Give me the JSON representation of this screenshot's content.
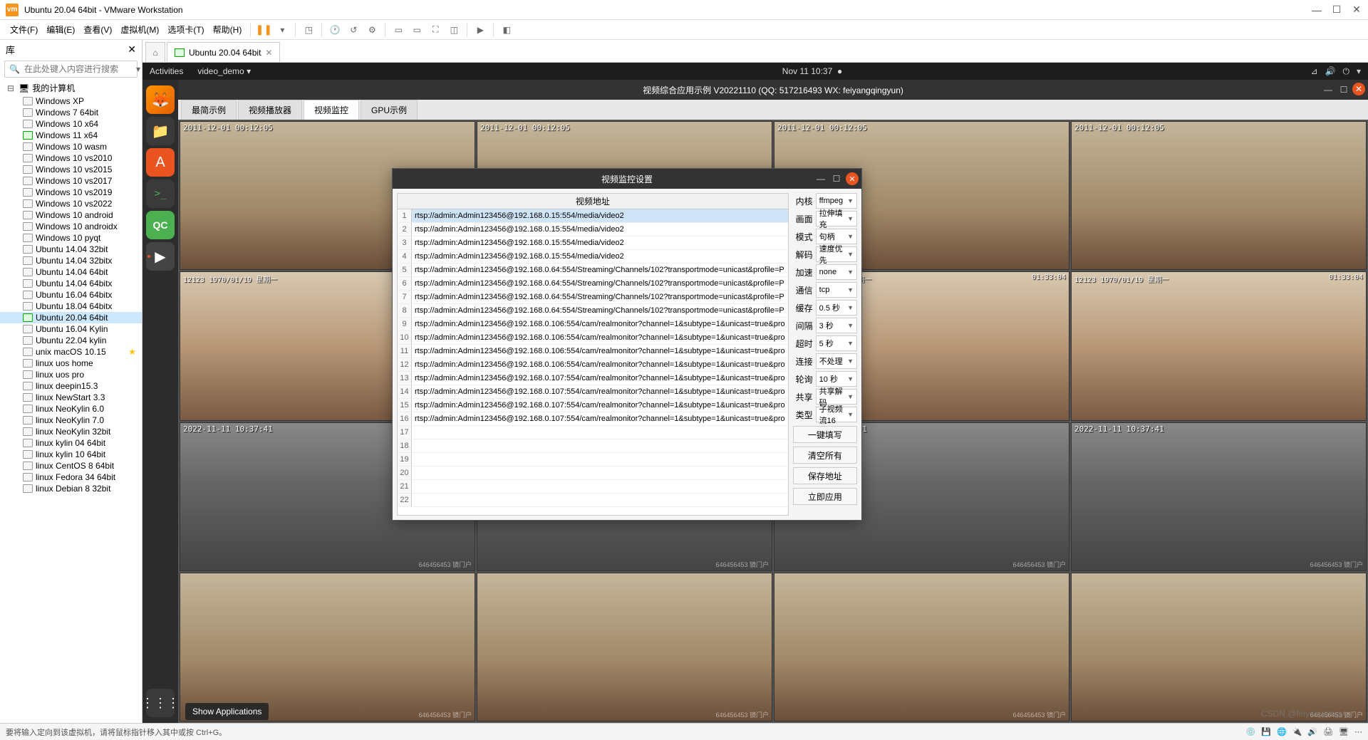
{
  "vmware": {
    "title": "Ubuntu 20.04 64bit - VMware Workstation",
    "menu": [
      "文件(F)",
      "编辑(E)",
      "查看(V)",
      "虚拟机(M)",
      "选项卡(T)",
      "帮助(H)"
    ],
    "tab_label": "Ubuntu 20.04 64bit",
    "status": "要将输入定向到该虚拟机，请将鼠标指针移入其中或按 Ctrl+G。"
  },
  "library": {
    "title": "库",
    "search_placeholder": "在此处键入内容进行搜索",
    "root": "我的计算机",
    "vms": [
      {
        "name": "Windows XP",
        "on": false
      },
      {
        "name": "Windows 7 64bit",
        "on": false
      },
      {
        "name": "Windows 10 x64",
        "on": false
      },
      {
        "name": "Windows 11 x64",
        "on": true
      },
      {
        "name": "Windows 10 wasm",
        "on": false
      },
      {
        "name": "Windows 10 vs2010",
        "on": false
      },
      {
        "name": "Windows 10 vs2015",
        "on": false
      },
      {
        "name": "Windows 10 vs2017",
        "on": false
      },
      {
        "name": "Windows 10 vs2019",
        "on": false
      },
      {
        "name": "Windows 10 vs2022",
        "on": false
      },
      {
        "name": "Windows 10 android",
        "on": false
      },
      {
        "name": "Windows 10 androidx",
        "on": false
      },
      {
        "name": "Windows 10 pyqt",
        "on": false
      },
      {
        "name": "Ubuntu 14.04 32bit",
        "on": false
      },
      {
        "name": "Ubuntu 14.04 32bitx",
        "on": false
      },
      {
        "name": "Ubuntu 14.04 64bit",
        "on": false
      },
      {
        "name": "Ubuntu 14.04 64bitx",
        "on": false
      },
      {
        "name": "Ubuntu 16.04 64bitx",
        "on": false
      },
      {
        "name": "Ubuntu 18.04 64bitx",
        "on": false
      },
      {
        "name": "Ubuntu 20.04 64bit",
        "on": true,
        "active": true
      },
      {
        "name": "Ubuntu 16.04 Kylin",
        "on": false
      },
      {
        "name": "Ubuntu 22.04 kylin",
        "on": false
      },
      {
        "name": "unix macOS 10.15",
        "on": false,
        "star": true
      },
      {
        "name": "linux uos home",
        "on": false
      },
      {
        "name": "linux uos pro",
        "on": false
      },
      {
        "name": "linux deepin15.3",
        "on": false
      },
      {
        "name": "linux NewStart 3.3",
        "on": false
      },
      {
        "name": "linux NeoKylin 6.0",
        "on": false
      },
      {
        "name": "linux NeoKylin 7.0",
        "on": false
      },
      {
        "name": "linux NeoKylin 32bit",
        "on": false
      },
      {
        "name": "linux kylin 04 64bit",
        "on": false
      },
      {
        "name": "linux kylin 10 64bit",
        "on": false
      },
      {
        "name": "linux CentOS 8 64bit",
        "on": false
      },
      {
        "name": "linux Fedora 34 64bit",
        "on": false
      },
      {
        "name": "linux Debian 8 32bit",
        "on": false
      }
    ]
  },
  "ubuntu": {
    "activities": "Activities",
    "app_menu": "video_demo",
    "clock": "Nov 11  10:37",
    "show_apps_tip": "Show Applications"
  },
  "vapp": {
    "title": "视频综合应用示例 V20221110 (QQ: 517216493 WX: feiyangqingyun)",
    "tabs": [
      "最简示例",
      "视频播放器",
      "视频监控",
      "GPU示例"
    ],
    "active_tab": 2,
    "timestamps_row1": "2011-12-01 00:12:05",
    "timestamps_row2a": "12123  1970/01/19 星期一",
    "timestamps_row2b": "01:33:04",
    "timestamps_row3": "2022-11-11 10:37:41",
    "wm_text": "646456453  镜门户"
  },
  "dialog": {
    "title": "视频监控设置",
    "addr_header": "视频地址",
    "addresses": [
      "rtsp://admin:Admin123456@192.168.0.15:554/media/video2",
      "rtsp://admin:Admin123456@192.168.0.15:554/media/video2",
      "rtsp://admin:Admin123456@192.168.0.15:554/media/video2",
      "rtsp://admin:Admin123456@192.168.0.15:554/media/video2",
      "rtsp://admin:Admin123456@192.168.0.64:554/Streaming/Channels/102?transportmode=unicast&profile=P",
      "rtsp://admin:Admin123456@192.168.0.64:554/Streaming/Channels/102?transportmode=unicast&profile=P",
      "rtsp://admin:Admin123456@192.168.0.64:554/Streaming/Channels/102?transportmode=unicast&profile=P",
      "rtsp://admin:Admin123456@192.168.0.64:554/Streaming/Channels/102?transportmode=unicast&profile=P",
      "rtsp://admin:Admin123456@192.168.0.106:554/cam/realmonitor?channel=1&subtype=1&unicast=true&pro",
      "rtsp://admin:Admin123456@192.168.0.106:554/cam/realmonitor?channel=1&subtype=1&unicast=true&pro",
      "rtsp://admin:Admin123456@192.168.0.106:554/cam/realmonitor?channel=1&subtype=1&unicast=true&pro",
      "rtsp://admin:Admin123456@192.168.0.106:554/cam/realmonitor?channel=1&subtype=1&unicast=true&pro",
      "rtsp://admin:Admin123456@192.168.0.107:554/cam/realmonitor?channel=1&subtype=1&unicast=true&pro",
      "rtsp://admin:Admin123456@192.168.0.107:554/cam/realmonitor?channel=1&subtype=1&unicast=true&pro",
      "rtsp://admin:Admin123456@192.168.0.107:554/cam/realmonitor?channel=1&subtype=1&unicast=true&pro",
      "rtsp://admin:Admin123456@192.168.0.107:554/cam/realmonitor?channel=1&subtype=1&unicast=true&pro"
    ],
    "total_rows": 22,
    "options": [
      {
        "label": "内核",
        "value": "ffmpeg"
      },
      {
        "label": "画面",
        "value": "拉伸填充"
      },
      {
        "label": "模式",
        "value": "句柄"
      },
      {
        "label": "解码",
        "value": "速度优先"
      },
      {
        "label": "加速",
        "value": "none"
      },
      {
        "label": "通信",
        "value": "tcp"
      },
      {
        "label": "缓存",
        "value": "0.5 秒"
      },
      {
        "label": "间隔",
        "value": "3 秒"
      },
      {
        "label": "超时",
        "value": "5 秒"
      },
      {
        "label": "连接",
        "value": "不处理"
      },
      {
        "label": "轮询",
        "value": "10 秒"
      },
      {
        "label": "共享",
        "value": "共享解码"
      },
      {
        "label": "类型",
        "value": "子视频流16"
      }
    ],
    "buttons": [
      "一键填写",
      "清空所有",
      "保存地址",
      "立即应用"
    ]
  },
  "watermark": "CSDN @feiyangqingyun"
}
